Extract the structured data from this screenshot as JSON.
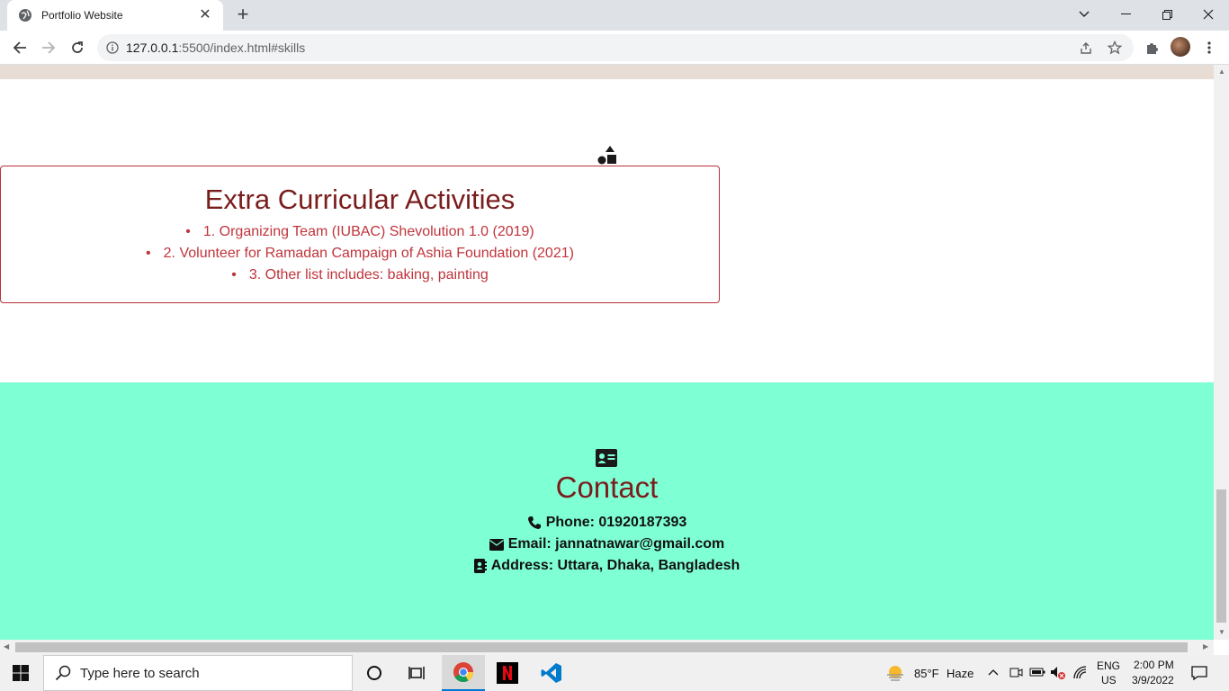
{
  "browser": {
    "tab_title": "Portfolio Website",
    "url_host": "127.0.0.1",
    "url_rest": ":5500/index.html#skills"
  },
  "extra_curricular": {
    "title": "Extra Curricular Activities",
    "items": [
      "1. Organizing Team (IUBAC) Shevolution 1.0 (2019)",
      "2. Volunteer for Ramadan Campaign of Ashia Foundation (2021)",
      "3. Other list includes: baking, painting"
    ]
  },
  "contact": {
    "title": "Contact",
    "phone": "Phone: 01920187393",
    "email": "Email: jannatnawar@gmail.com",
    "address": "Address: Uttara, Dhaka, Bangladesh"
  },
  "taskbar": {
    "search_placeholder": "Type here to search",
    "weather_temp": "85°F",
    "weather_desc": "Haze",
    "lang_1": "ENG",
    "lang_2": "US",
    "time": "2:00 PM",
    "date": "3/9/2022"
  },
  "colors": {
    "contact_bg": "#7fffd4",
    "heading": "#7a1d1d",
    "list_text": "#c0343c"
  }
}
